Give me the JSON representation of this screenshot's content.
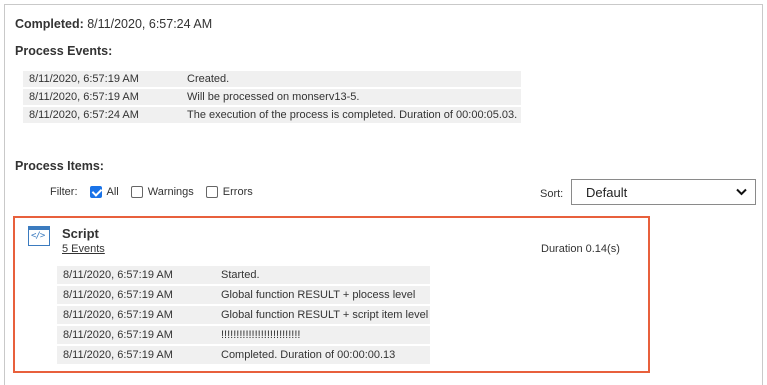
{
  "header": {
    "completed_label": "Completed:",
    "completed_value": "8/11/2020, 6:57:24 AM"
  },
  "process_events": {
    "title": "Process Events:",
    "rows": [
      {
        "time": "8/11/2020, 6:57:19 AM",
        "message": "Created."
      },
      {
        "time": "8/11/2020, 6:57:19 AM",
        "message": "Will be processed on monserv13-5."
      },
      {
        "time": "8/11/2020, 6:57:24 AM",
        "message": "The execution of the process is completed. Duration of 00:00:05.03."
      }
    ]
  },
  "process_items": {
    "title": "Process Items:",
    "filter": {
      "label": "Filter:",
      "options": [
        {
          "label": "All",
          "checked": true
        },
        {
          "label": "Warnings",
          "checked": false
        },
        {
          "label": "Errors",
          "checked": false
        }
      ]
    },
    "sort": {
      "label": "Sort:",
      "selected": "Default"
    },
    "items": [
      {
        "name": "Script",
        "events_link": "5 Events",
        "duration": "Duration 0.14(s)",
        "icon": "script-icon",
        "events": [
          {
            "time": "8/11/2020, 6:57:19 AM",
            "message": "Started."
          },
          {
            "time": "8/11/2020, 6:57:19 AM",
            "message": "Global function RESULT + plocess level"
          },
          {
            "time": "8/11/2020, 6:57:19 AM",
            "message": "Global function RESULT + script item level"
          },
          {
            "time": "8/11/2020, 6:57:19 AM",
            "message": "!!!!!!!!!!!!!!!!!!!!!!!!!!"
          },
          {
            "time": "8/11/2020, 6:57:19 AM",
            "message": "Completed. Duration of 00:00:00.13"
          }
        ]
      }
    ]
  },
  "colors": {
    "highlight_border": "#e8603c",
    "checkbox_checked": "#1a73e8",
    "icon_blue": "#3b7bbf",
    "row_bg": "#f0f0f0"
  }
}
